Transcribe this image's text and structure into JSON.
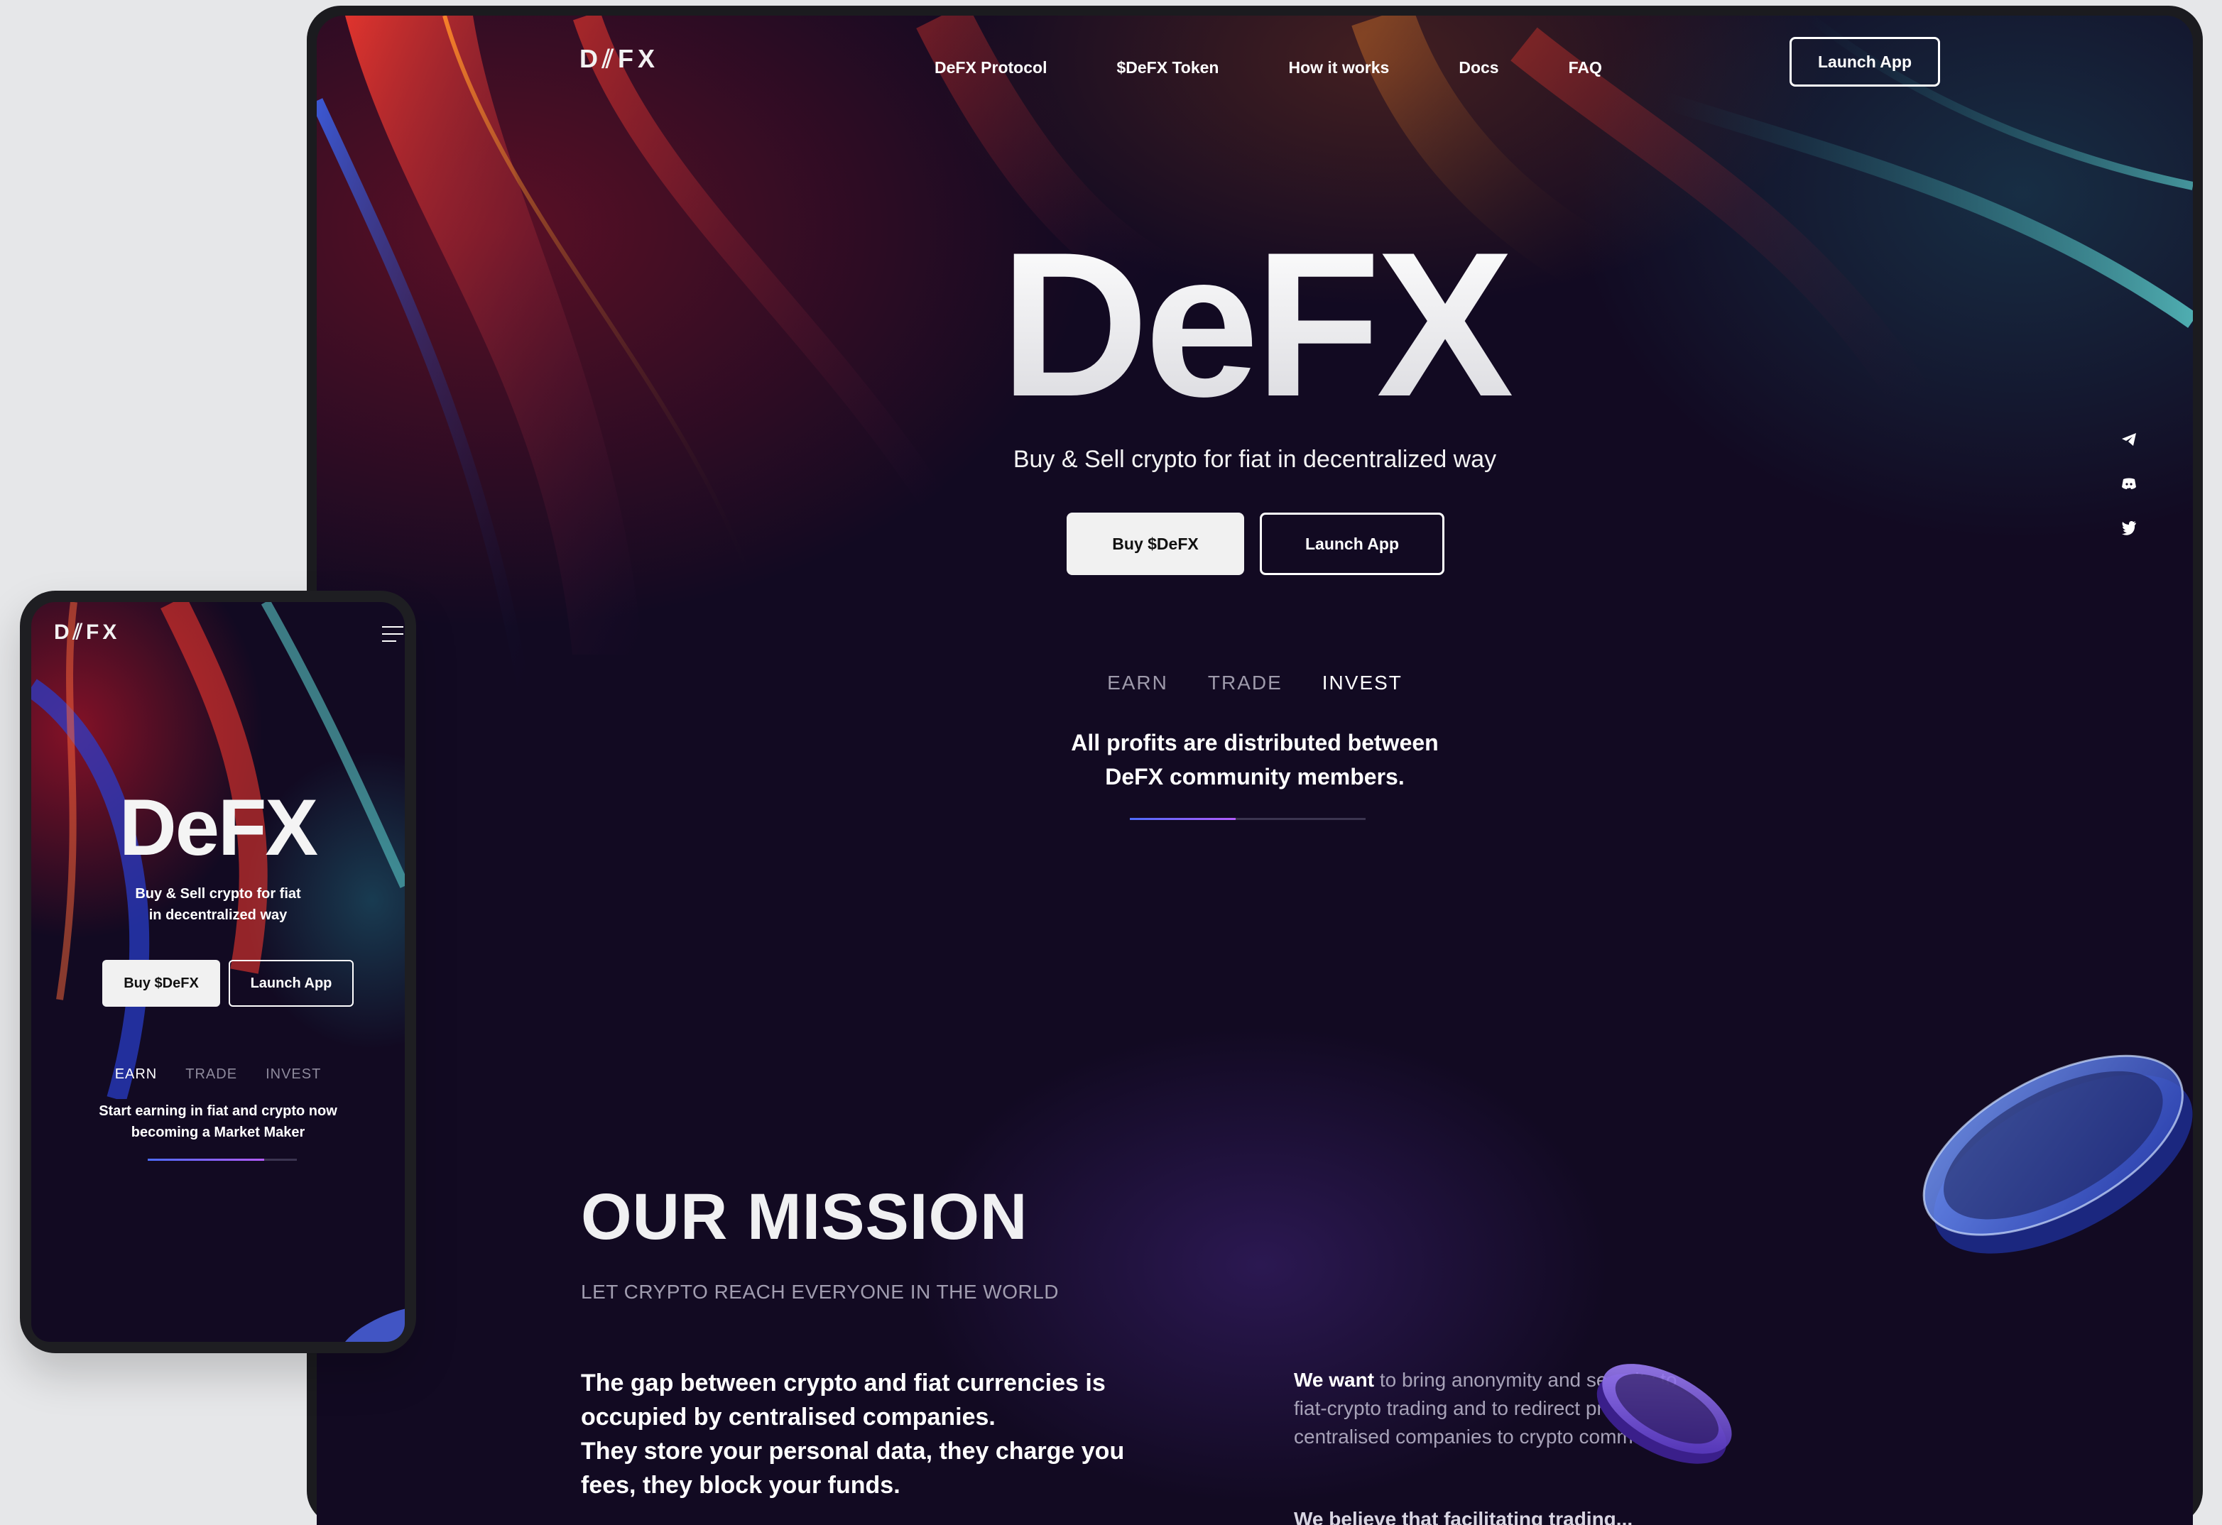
{
  "desktop": {
    "nav": {
      "logo": "D⫽FX",
      "links": [
        "DeFX Protocol",
        "$DeFX Token",
        "How it works",
        "Docs",
        "FAQ"
      ],
      "launch_label": "Launch App"
    },
    "hero": {
      "title": "DeFX",
      "subtitle": "Buy & Sell crypto for fiat in decentralized way",
      "buy_label": "Buy $DeFX",
      "launch_label": "Launch App"
    },
    "tabs": {
      "items": [
        "EARN",
        "TRADE",
        "INVEST"
      ],
      "active": "INVEST",
      "description_line1": "All profits are distributed between",
      "description_line2": "DeFX community members.",
      "progress": 0.45
    },
    "socials": [
      "telegram-icon",
      "discord-icon",
      "twitter-icon"
    ],
    "mission": {
      "title": "OUR MISSION",
      "subtitle": "LET CRYPTO REACH EVERYONE IN THE WORLD",
      "left_line1": "The gap between crypto and fiat currencies is occupied by centralised companies.",
      "left_line2": "They store your personal data, they charge you fees, they block your funds.",
      "right_highlight": "We want",
      "right_text": " to bring anonymity and security to fiat-crypto trading and to redirect profits from centralised companies to crypto community.",
      "right_second": "We believe that facilitating trading..."
    }
  },
  "mobile": {
    "logo": "D⫽FX",
    "hero": {
      "title": "DeFX",
      "subtitle_line1": "Buy & Sell crypto for fiat",
      "subtitle_line2": "in decentralized way",
      "buy_label": "Buy $DeFX",
      "launch_label": "Launch App"
    },
    "tabs": {
      "items": [
        "EARN",
        "TRADE",
        "INVEST"
      ],
      "active": "EARN",
      "description_line1": "Start earning in fiat and crypto now",
      "description_line2": "becoming a Market Maker",
      "progress": 0.78
    }
  },
  "colors": {
    "background": "#120a22",
    "accent_blue": "#4d6cff",
    "accent_purple": "#b45cff",
    "outer": "#e6e7e9"
  }
}
